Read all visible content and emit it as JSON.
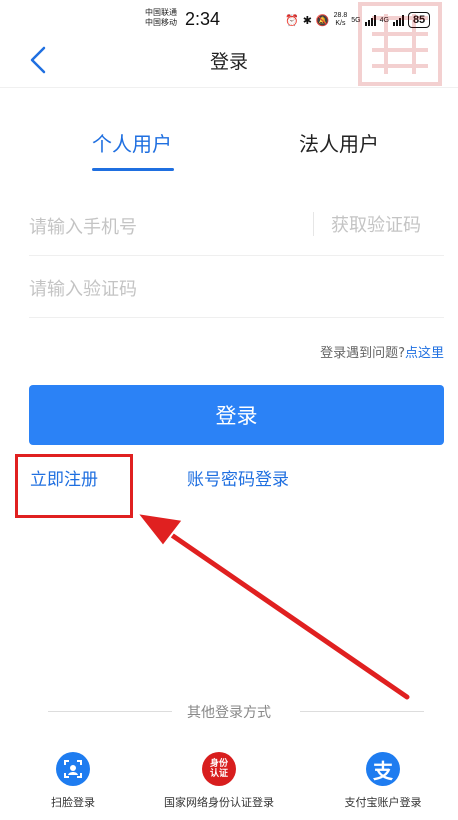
{
  "status_bar": {
    "carrier1": "中国联通",
    "carrier2": "中国移动",
    "time": "2:34",
    "speed_value": "28.8",
    "speed_unit": "K/s",
    "net1": "5G",
    "net2": "4G",
    "battery": "85"
  },
  "nav": {
    "title": "登录"
  },
  "tabs": [
    {
      "label": "个人用户",
      "active": true
    },
    {
      "label": "法人用户",
      "active": false
    }
  ],
  "form": {
    "phone_placeholder": "请输入手机号",
    "get_code_label": "获取验证码",
    "code_placeholder": "请输入验证码"
  },
  "help": {
    "text": "登录遇到问题?",
    "link": "点这里"
  },
  "login_button": "登录",
  "links": {
    "register": "立即注册",
    "password_login": "账号密码登录"
  },
  "other_login": {
    "title": "其他登录方式",
    "methods": [
      {
        "label": "扫脸登录",
        "icon": "face-scan-icon"
      },
      {
        "label": "国家网络身份认证登录",
        "icon": "id-auth-icon",
        "icon_text": "身份认证"
      },
      {
        "label": "支付宝账户登录",
        "icon": "alipay-icon",
        "icon_text": "支"
      }
    ]
  },
  "colors": {
    "primary": "#2b82f6",
    "link": "#1f6fe0",
    "annotation": "#e02020",
    "id_badge": "#d81e1e",
    "alipay": "#1e7cf0"
  }
}
